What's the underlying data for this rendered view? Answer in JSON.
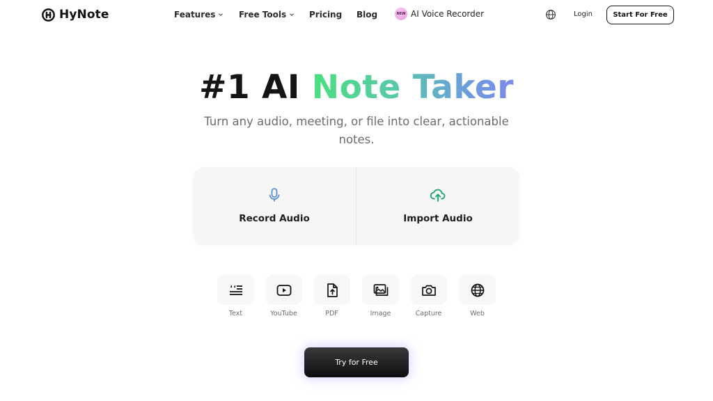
{
  "brand": {
    "name": "HyNote"
  },
  "nav": {
    "features": "Features",
    "free_tools": "Free Tools",
    "pricing": "Pricing",
    "blog": "Blog",
    "new_badge": "NEW",
    "recorder": "AI Voice Recorder"
  },
  "header": {
    "login": "Login",
    "start_free": "Start For Free"
  },
  "hero": {
    "title_plain": "#1 AI",
    "title_highlight": "Note Taker",
    "subtitle": "Turn any audio, meeting, or file into clear, actionable notes."
  },
  "actions": {
    "record": "Record Audio",
    "import": "Import Audio"
  },
  "tools": [
    {
      "label": "Text",
      "icon": "text-quote-icon"
    },
    {
      "label": "YouTube",
      "icon": "youtube-play-icon"
    },
    {
      "label": "PDF",
      "icon": "file-upload-icon"
    },
    {
      "label": "Image",
      "icon": "image-icon"
    },
    {
      "label": "Capture",
      "icon": "camera-icon"
    },
    {
      "label": "Web",
      "icon": "globe-icon"
    }
  ],
  "cta": {
    "try_free": "Try for Free"
  },
  "colors": {
    "accent_green": "#4be07f",
    "accent_blue": "#7b8ae8",
    "mic_blue": "#5b8fd6",
    "upload_green": "#1aa36a",
    "dark": "#111111"
  }
}
